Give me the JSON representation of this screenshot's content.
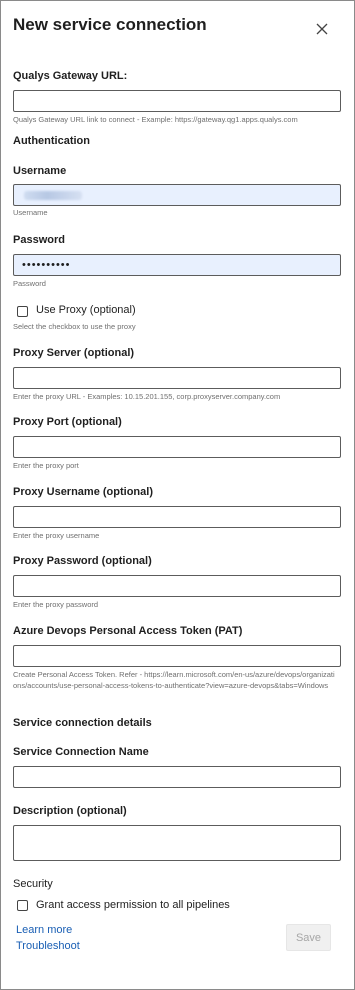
{
  "header": {
    "title": "New service connection",
    "close_icon": "close-icon"
  },
  "fields": {
    "gateway_url": {
      "label": "Qualys Gateway URL:",
      "value": "",
      "help": "Qualys Gateway URL link to connect - Example: https://gateway.qg1.apps.qualys.com"
    },
    "authentication": {
      "heading": "Authentication"
    },
    "username": {
      "label": "Username",
      "help": "Username"
    },
    "password": {
      "label": "Password",
      "value": "••••••••••",
      "help": "Password"
    },
    "use_proxy": {
      "label": "Use Proxy (optional)",
      "checked": false,
      "help": "Select the checkbox to use the proxy"
    },
    "proxy_server": {
      "label": "Proxy Server (optional)",
      "value": "",
      "help": "Enter the proxy URL - Examples: 10.15.201.155, corp.proxyserver.company.com"
    },
    "proxy_port": {
      "label": "Proxy Port (optional)",
      "value": "",
      "help": "Enter the proxy port"
    },
    "proxy_username": {
      "label": "Proxy Username (optional)",
      "value": "",
      "help": "Enter the proxy username"
    },
    "proxy_password": {
      "label": "Proxy Password (optional)",
      "value": "",
      "help": "Enter the proxy password"
    },
    "pat": {
      "label": "Azure Devops Personal Access Token (PAT)",
      "value": "",
      "help": "Create Personal Access Token. Refer - https://learn.microsoft.com/en-us/azure/devops/organizations/accounts/use-personal-access-tokens-to-authenticate?view=azure-devops&tabs=Windows"
    }
  },
  "service_details": {
    "heading": "Service connection details",
    "name": {
      "label": "Service Connection Name",
      "value": ""
    },
    "description": {
      "label": "Description (optional)",
      "value": ""
    }
  },
  "security": {
    "heading": "Security",
    "grant_label": "Grant access permission to all pipelines",
    "checked": false
  },
  "footer": {
    "learn_more": "Learn more",
    "troubleshoot": "Troubleshoot",
    "save_label": "Save"
  },
  "colors": {
    "filled_input_bg": "#e8f0fe",
    "link": "#1a5fb4",
    "disabled_button_bg": "#f0f0f0",
    "disabled_button_text": "#a6a6a6"
  }
}
